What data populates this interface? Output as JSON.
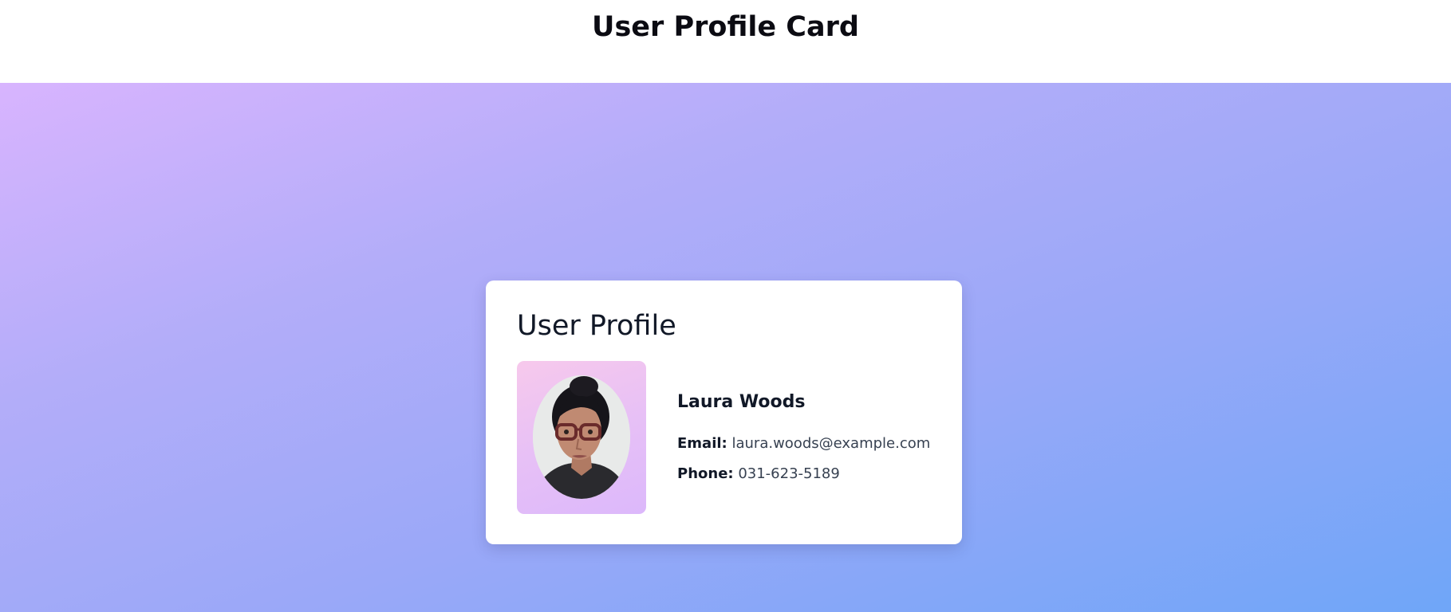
{
  "page": {
    "title": "User Profile Card"
  },
  "card": {
    "title": "User Profile",
    "name": "Laura Woods",
    "email_label": "Email:",
    "email": "laura.woods@example.com",
    "phone_label": "Phone:",
    "phone": "031-623-5189"
  },
  "colors": {
    "gradient_start": "#d8b4fe",
    "gradient_end": "#6fa6f8",
    "card_background": "#ffffff",
    "avatar_frame_start": "#f7c9ec",
    "avatar_frame_end": "#dcb8fb"
  }
}
